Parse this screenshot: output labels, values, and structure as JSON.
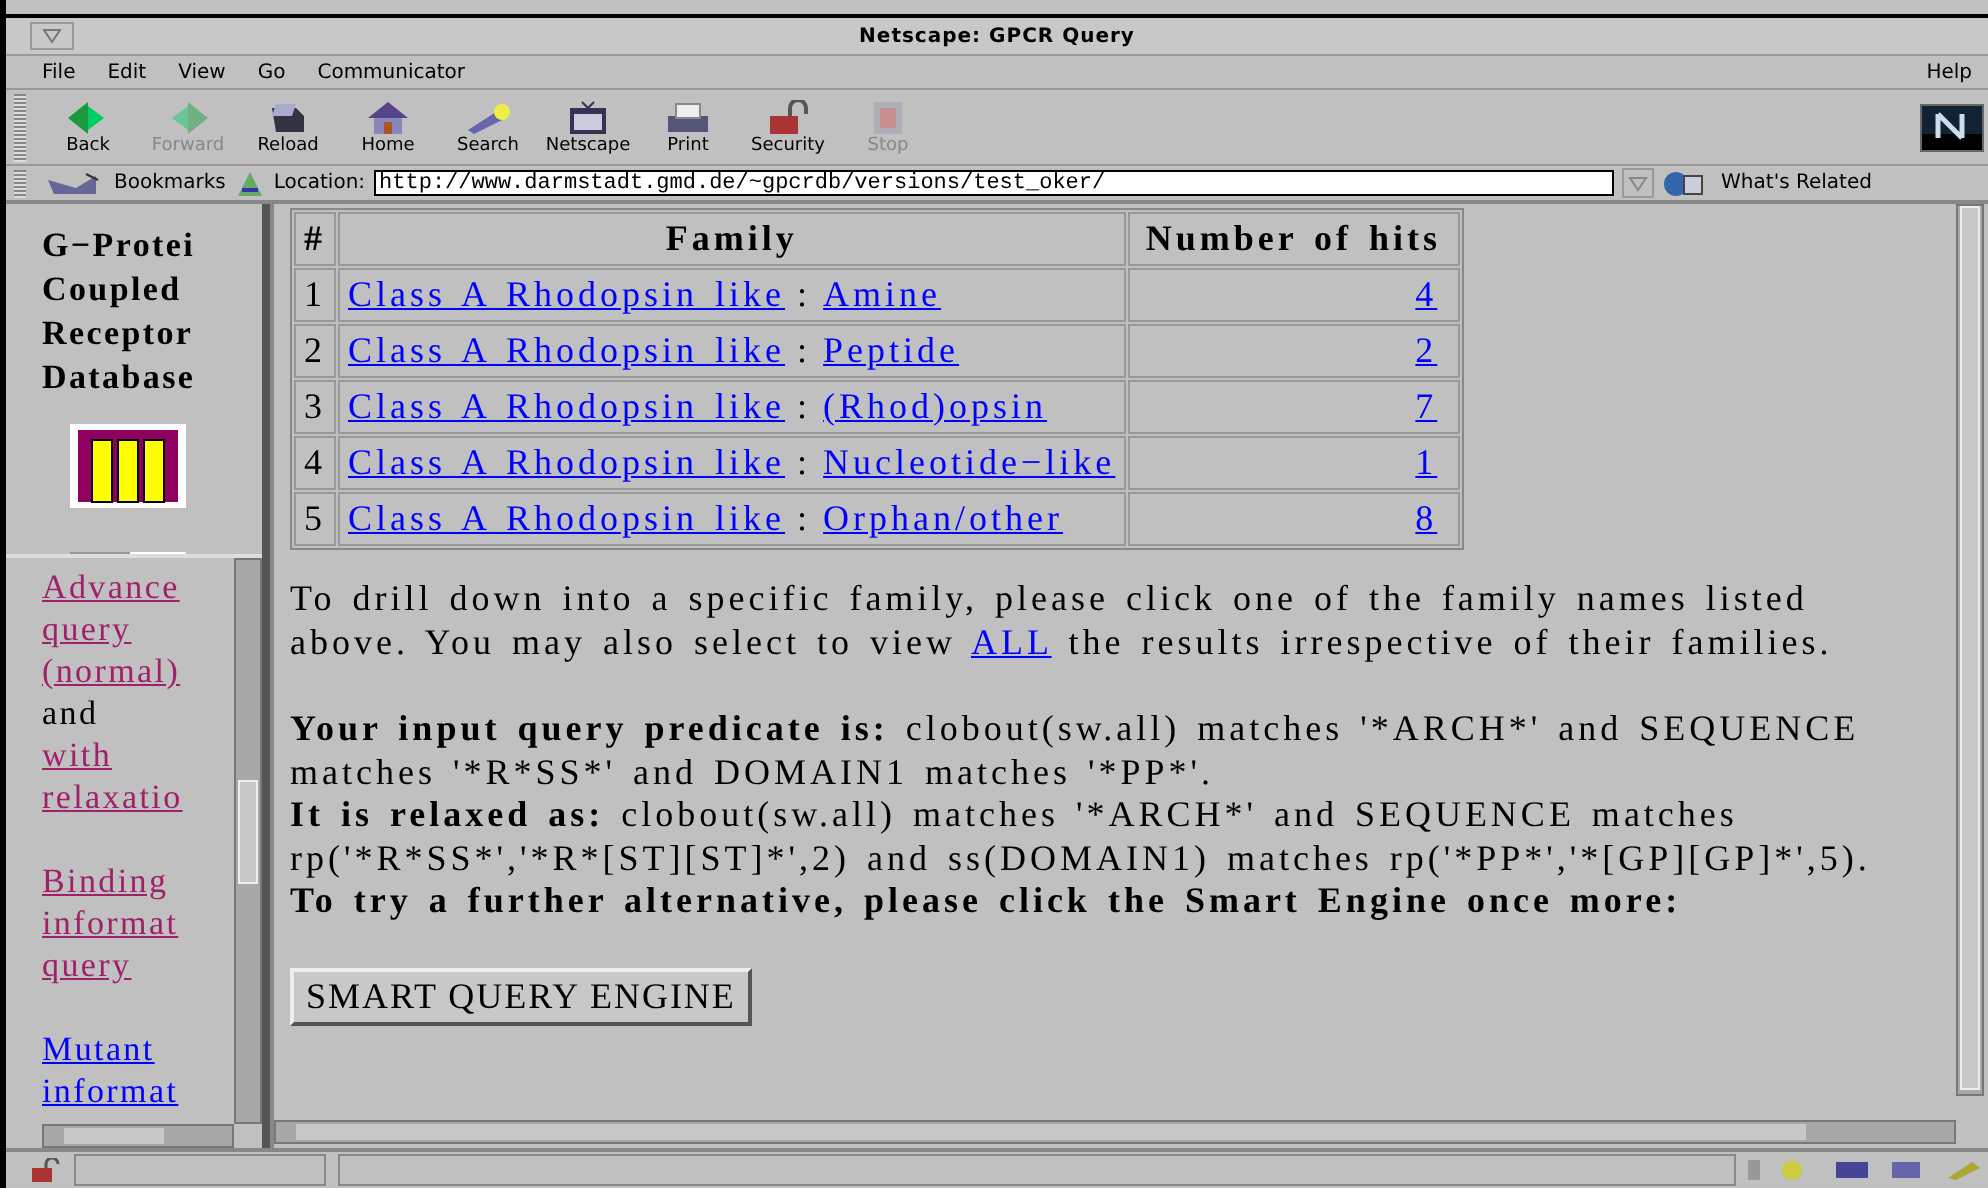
{
  "window": {
    "title": "Netscape: GPCR Query"
  },
  "menu": [
    "File",
    "Edit",
    "View",
    "Go",
    "Communicator"
  ],
  "help_menu": "Help",
  "toolbar": [
    {
      "label": "Back",
      "kind": "back",
      "disabled": false
    },
    {
      "label": "Forward",
      "kind": "forward",
      "disabled": true
    },
    {
      "label": "Reload",
      "kind": "reload",
      "disabled": false
    },
    {
      "label": "Home",
      "kind": "home",
      "disabled": false
    },
    {
      "label": "Search",
      "kind": "search",
      "disabled": false
    },
    {
      "label": "Netscape",
      "kind": "netscape",
      "disabled": false
    },
    {
      "label": "Print",
      "kind": "print",
      "disabled": false
    },
    {
      "label": "Security",
      "kind": "security",
      "disabled": false
    },
    {
      "label": "Stop",
      "kind": "stop",
      "disabled": true
    }
  ],
  "location_bar": {
    "bookmarks": "Bookmarks",
    "location_label": "Location:",
    "url": "http://www.darmstadt.gmd.de/~gpcrdb/versions/test_oker/",
    "related": "What's Related"
  },
  "sidebar": {
    "title": [
      "G−Protei",
      "Coupled",
      "Receptor",
      "Database"
    ],
    "groups": [
      [
        {
          "text": "Advance",
          "kind": "link",
          "visited": true
        },
        {
          "text": "query",
          "kind": "link",
          "visited": true
        },
        {
          "text": "(normal)",
          "kind": "link",
          "visited": true
        },
        {
          "text": "and",
          "kind": "text"
        },
        {
          "text": "with",
          "kind": "link",
          "visited": true
        },
        {
          "text": "relaxatio",
          "kind": "link",
          "visited": true
        }
      ],
      [
        {
          "text": "Binding",
          "kind": "link",
          "visited": true
        },
        {
          "text": "informat",
          "kind": "link",
          "visited": true
        },
        {
          "text": "query",
          "kind": "link",
          "visited": true
        }
      ],
      [
        {
          "text": "Mutant",
          "kind": "link",
          "visited": false
        },
        {
          "text": "informat",
          "kind": "link",
          "visited": false
        }
      ]
    ]
  },
  "table": {
    "columns": [
      "#",
      "Family",
      "Number of hits"
    ],
    "rows": [
      {
        "index": "1",
        "class": "Class A Rhodopsin like",
        "separator": ":",
        "family": "Amine",
        "hits": "4"
      },
      {
        "index": "2",
        "class": "Class A Rhodopsin like",
        "separator": ":",
        "family": "Peptide",
        "hits": "2"
      },
      {
        "index": "3",
        "class": "Class A Rhodopsin like",
        "separator": ":",
        "family": "(Rhod)opsin",
        "hits": "7"
      },
      {
        "index": "4",
        "class": "Class A Rhodopsin like",
        "separator": ":",
        "family": "Nucleotide−like",
        "hits": "1"
      },
      {
        "index": "5",
        "class": "Class A Rhodopsin like",
        "separator": ":",
        "family": "Orphan/other",
        "hits": "8"
      }
    ]
  },
  "intro": {
    "before": "To drill down into a specific family, please click one of the family names listed above. You may also select to view",
    "link": "ALL",
    "after": "the results irrespective of their families."
  },
  "query_lines": [
    [
      {
        "text": "Your input query predicate is:",
        "bold": true
      },
      {
        "text": " clobout(sw.all) matches '*ARCH*' and SEQUENCE matches '*R*SS*' and DOMAIN1 matches '*PP*'.",
        "bold": false
      }
    ],
    [
      {
        "text": "It is relaxed as:",
        "bold": true
      },
      {
        "text": " clobout(sw.all) matches '*ARCH*' and SEQUENCE matches rp('*R*SS*','*R*[ST][ST]*',2) and ss(DOMAIN1) matches rp('*PP*','*[GP][GP]*',5).",
        "bold": false
      }
    ],
    [
      {
        "text": "To try a further alternative, please click the Smart Engine once more:",
        "bold": true
      }
    ]
  ],
  "engine_button": "SMART QUERY ENGINE"
}
